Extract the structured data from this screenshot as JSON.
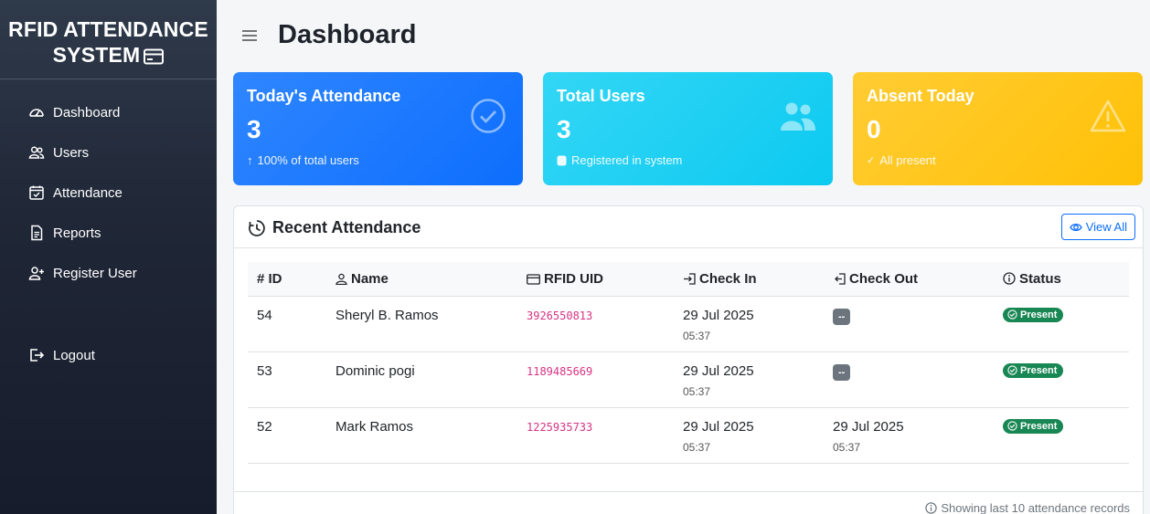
{
  "sidebar": {
    "brand_line1": "RFID ATTENDANCE",
    "brand_line2": "SYSTEM",
    "brand_icon": "card-icon",
    "items": [
      {
        "label": "Dashboard",
        "icon": "speedometer-icon"
      },
      {
        "label": "Users",
        "icon": "people-icon"
      },
      {
        "label": "Attendance",
        "icon": "calendar-check-icon"
      },
      {
        "label": "Reports",
        "icon": "file-text-icon"
      },
      {
        "label": "Register User",
        "icon": "person-plus-icon"
      }
    ],
    "logout": {
      "label": "Logout",
      "icon": "logout-icon"
    }
  },
  "header": {
    "title": "Dashboard",
    "menu_icon": "hamburger-icon"
  },
  "cards": [
    {
      "title": "Today's Attendance",
      "value": "3",
      "sub": "100% of total users",
      "sub_icon": "arrow-up-icon",
      "icon": "check-circle-icon",
      "color": "#0d6efd"
    },
    {
      "title": "Total Users",
      "value": "3",
      "sub": "Registered in system",
      "sub_icon": "database-icon",
      "icon": "people-icon",
      "color": "#0dcaf0"
    },
    {
      "title": "Absent Today",
      "value": "0",
      "sub": "All present",
      "sub_icon": "check-icon",
      "icon": "warning-icon",
      "color": "#ffc107"
    }
  ],
  "panel": {
    "title": "Recent Attendance",
    "view_all": "View All",
    "columns": [
      "# ID",
      "Name",
      "RFID UID",
      "Check In",
      "Check Out",
      "Status"
    ],
    "rows": [
      {
        "id": "54",
        "name": "Sheryl B. Ramos",
        "uid": "3926550813",
        "in_date": "29 Jul 2025",
        "in_time": "05:37",
        "out_date": "",
        "out_time": "",
        "out_badge": "--",
        "status": "Present"
      },
      {
        "id": "53",
        "name": "Dominic pogi",
        "uid": "1189485669",
        "in_date": "29 Jul 2025",
        "in_time": "05:37",
        "out_date": "",
        "out_time": "",
        "out_badge": "--",
        "status": "Present"
      },
      {
        "id": "52",
        "name": "Mark Ramos",
        "uid": "1225935733",
        "in_date": "29 Jul 2025",
        "in_time": "05:37",
        "out_date": "29 Jul 2025",
        "out_time": "05:37",
        "out_badge": "",
        "status": "Present"
      }
    ],
    "footer": "Showing last 10 attendance records"
  },
  "colors": {
    "sidebar": "#1f2636",
    "primary": "#0d6efd",
    "success": "#198754",
    "uid": "#d63384"
  }
}
